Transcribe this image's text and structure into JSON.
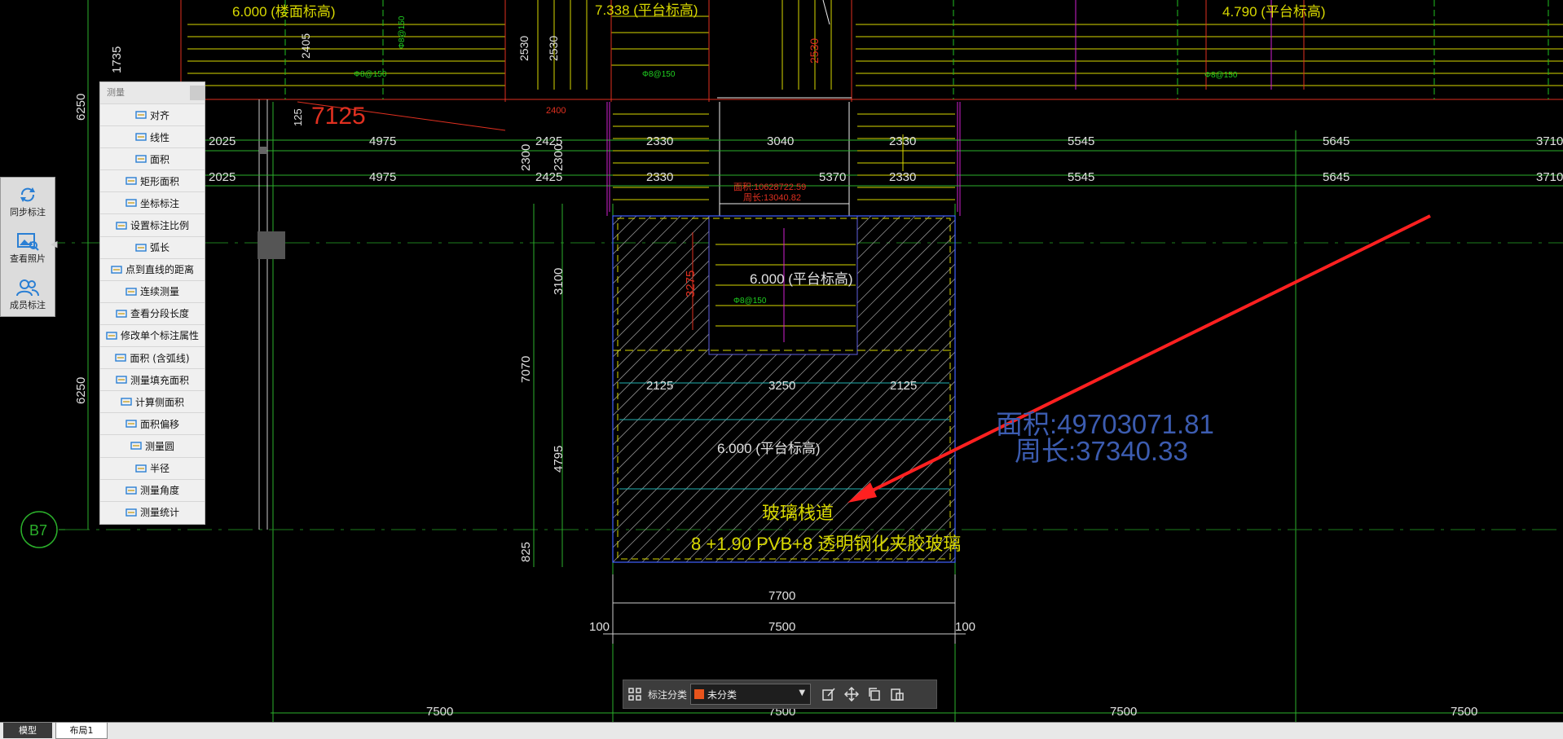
{
  "measure_panel": {
    "title": "测量",
    "items": [
      {
        "label": "对齐",
        "icon": "align-dimension-icon"
      },
      {
        "label": "线性",
        "icon": "linear-dimension-icon"
      },
      {
        "label": "面积",
        "icon": "area-icon"
      },
      {
        "label": "矩形面积",
        "icon": "rect-area-icon"
      },
      {
        "label": "坐标标注",
        "icon": "coordinate-icon"
      },
      {
        "label": "设置标注比例",
        "icon": "scale-icon"
      },
      {
        "label": "弧长",
        "icon": "arc-length-icon"
      },
      {
        "label": "点到直线的距离",
        "icon": "point-line-distance-icon"
      },
      {
        "label": "连续测量",
        "icon": "continuous-measure-icon"
      },
      {
        "label": "查看分段长度",
        "icon": "segment-length-icon"
      },
      {
        "label": "修改单个标注属性",
        "icon": "edit-annotation-icon"
      },
      {
        "label": "面积 (含弧线)",
        "icon": "arc-area-icon"
      },
      {
        "label": "测量填充面积",
        "icon": "hatch-area-icon"
      },
      {
        "label": "计算侧面积",
        "icon": "side-area-icon"
      },
      {
        "label": "面积偏移",
        "icon": "area-offset-icon"
      },
      {
        "label": "测量圆",
        "icon": "circle-icon"
      },
      {
        "label": "半径",
        "icon": "radius-icon"
      },
      {
        "label": "测量角度",
        "icon": "angle-icon"
      },
      {
        "label": "测量统计",
        "icon": "statistics-icon"
      }
    ]
  },
  "left_strip": {
    "sync": "同步标注",
    "photos": "查看照片",
    "members": "成员标注"
  },
  "toolbar": {
    "category_label": "标注分类",
    "category_value": "未分类",
    "swatch_color": "#e8541c"
  },
  "tabs": {
    "model": "模型",
    "layout1": "布局1"
  },
  "drawing": {
    "top_labels": {
      "floor_elev": "6.000 (楼面标高)",
      "platform_mid": "7.338 (平台标高)",
      "platform_right": "4.790 (平台标高)",
      "dim_7125": "7125",
      "dim_125": "125",
      "dim_2400": "2400"
    },
    "row1": [
      "2025",
      "4975",
      "2425",
      "2330",
      "3040",
      "2330",
      "5545",
      "5645",
      "3710"
    ],
    "row2": [
      "2025",
      "4975",
      "2425",
      "2330",
      "5370",
      "2330",
      "5545",
      "5645",
      "3710"
    ],
    "red_small": {
      "area": "面积:10628722.59",
      "perimeter": "周长:13040.82"
    },
    "platform_inner": "6.000 (平台标高)",
    "platform_lower": "6.000 (平台标高)",
    "inner_dims": [
      "2125",
      "3250",
      "2125"
    ],
    "measure_overlay": {
      "area": "面积:49703071.81",
      "perimeter": "周长:37340.33"
    },
    "glass_title": "玻璃栈道",
    "glass_spec": "8 +1.90 PVB+8 透明钢化夹胶玻璃",
    "bottom_dims": {
      "overall": "7700",
      "inner": "7500",
      "left": "100",
      "right": "100"
    },
    "grid_dims": [
      "7500",
      "7500",
      "7500",
      "7500"
    ],
    "left_vertical": [
      "6250",
      "6250",
      "1735"
    ],
    "vertical_dims": [
      "3100",
      "7070",
      "4795",
      "825",
      "2300",
      "2300",
      "3275"
    ],
    "grid_bubble": "B7",
    "rebar_labels": [
      "Φ8@150",
      "Φ8@150",
      "Φ8@150",
      "Φ8@150",
      "Φ8@150"
    ],
    "small_dims": [
      "2405",
      "2530",
      "2530",
      "2530"
    ]
  }
}
